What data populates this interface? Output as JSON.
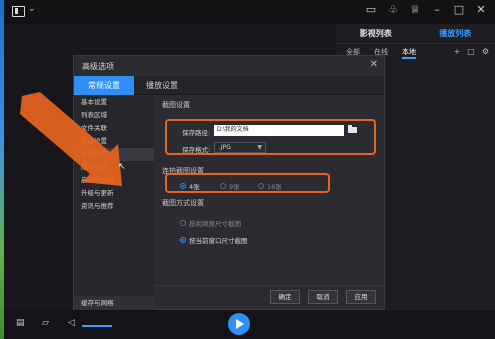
{
  "titlebar_icons": [
    "tv-icon",
    "bell-icon",
    "crown-icon",
    "minimize-icon",
    "maximize-icon",
    "close-icon"
  ],
  "playlist": {
    "tabs": [
      "影视列表",
      "播放列表"
    ],
    "active_tab": 1,
    "subtabs": [
      "全部",
      "在线",
      "本地"
    ],
    "active_subtab": 2,
    "tools": [
      "+",
      "□",
      "⚙"
    ]
  },
  "dialog": {
    "title": "高级选项",
    "tabs": [
      "常规设置",
      "播放设置"
    ],
    "menu": [
      "基本设置",
      "列表区域",
      "文件关联",
      "热键设置",
      "截图设置",
      "隐私设置",
      "启动与退出",
      "升级与更新",
      "资讯与推荐"
    ],
    "active_menu_index": 4,
    "menu_bottom": "缓存与网络",
    "screenshot_section_title": "截图设置",
    "save_path_label": "保存路径:",
    "save_path_value": "D:\\我的文档",
    "save_format_label": "保存格式:",
    "save_format_value": ".JPG",
    "burst_section_title": "连拍截图设置",
    "burst_options": [
      "4张",
      "9张",
      "16张"
    ],
    "burst_selected": 0,
    "mode_section_title": "截图方式设置",
    "mode_options": [
      "按视频原尺寸截图",
      "按当前窗口尺寸截图"
    ],
    "mode_selected": 1,
    "buttons": {
      "ok": "确定",
      "cancel": "取消",
      "apply": "应用"
    }
  },
  "colors": {
    "accent": "#2f8ff5",
    "highlight": "#e8641e"
  }
}
